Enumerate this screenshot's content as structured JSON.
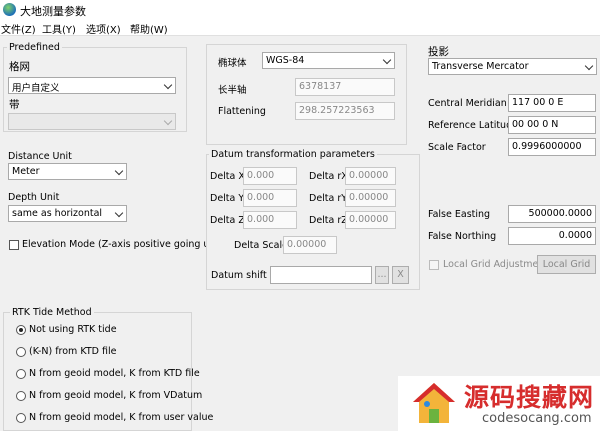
{
  "window": {
    "title": "大地测量参数"
  },
  "menu": [
    "文件(Z)",
    "工具(Y)",
    "选项(X)",
    "帮助(W)"
  ],
  "predefined": {
    "group_label": "Predefined",
    "grid_label": "格网",
    "grid_value": "用户自定义",
    "zone_label": "带",
    "zone_value": ""
  },
  "ellipsoid": {
    "label": "椭球体",
    "value": "WGS-84",
    "semi_major_label": "长半轴",
    "semi_major_value": "6378137",
    "flattening_label": "Flattening",
    "flattening_value": "298.257223563"
  },
  "projection": {
    "label": "投影",
    "value": "Transverse Mercator",
    "central_meridian_label": "Central Meridian",
    "central_meridian_value": "117 00 0 E",
    "ref_latitude_label": "Reference Latitude",
    "ref_latitude_value": "00 00 0 N",
    "scale_factor_label": "Scale Factor",
    "scale_factor_value": "0.9996000000",
    "false_easting_label": "False Easting",
    "false_easting_value": "500000.0000",
    "false_northing_label": "False Northing",
    "false_northing_value": "0.0000",
    "local_grid_check_label": "Local Grid Adjustment",
    "local_grid_button": "Local Grid"
  },
  "units": {
    "distance_label": "Distance Unit",
    "distance_value": "Meter",
    "depth_label": "Depth Unit",
    "depth_value": "same as horizontal",
    "elevation_mode_label": "Elevation Mode (Z-axis positive going up)"
  },
  "datum": {
    "group_label": "Datum transformation parameters",
    "delta_x_label": "Delta X",
    "delta_x_value": "0.000",
    "delta_y_label": "Delta Y",
    "delta_y_value": "0.000",
    "delta_z_label": "Delta Z",
    "delta_z_value": "0.000",
    "delta_rx_label": "Delta rX",
    "delta_rx_value": "0.00000",
    "delta_ry_label": "Delta rY",
    "delta_ry_value": "0.00000",
    "delta_rz_label": "Delta rZ",
    "delta_rz_value": "0.00000",
    "delta_scale_label": "Delta Scale",
    "delta_scale_value": "0.00000",
    "shift_file_label": "Datum shift file",
    "shift_file_value": "",
    "browse_label": "...",
    "clear_label": "X"
  },
  "rtk": {
    "group_label": "RTK Tide Method",
    "options": [
      "Not using RTK tide",
      "(K-N) from KTD file",
      "N from geoid model, K from KTD file",
      "N from geoid model, K from VDatum",
      "N from geoid model, K from user value"
    ],
    "selected_index": 0
  },
  "watermark": {
    "text": "源码搜藏网",
    "url": "codesocang.com"
  }
}
